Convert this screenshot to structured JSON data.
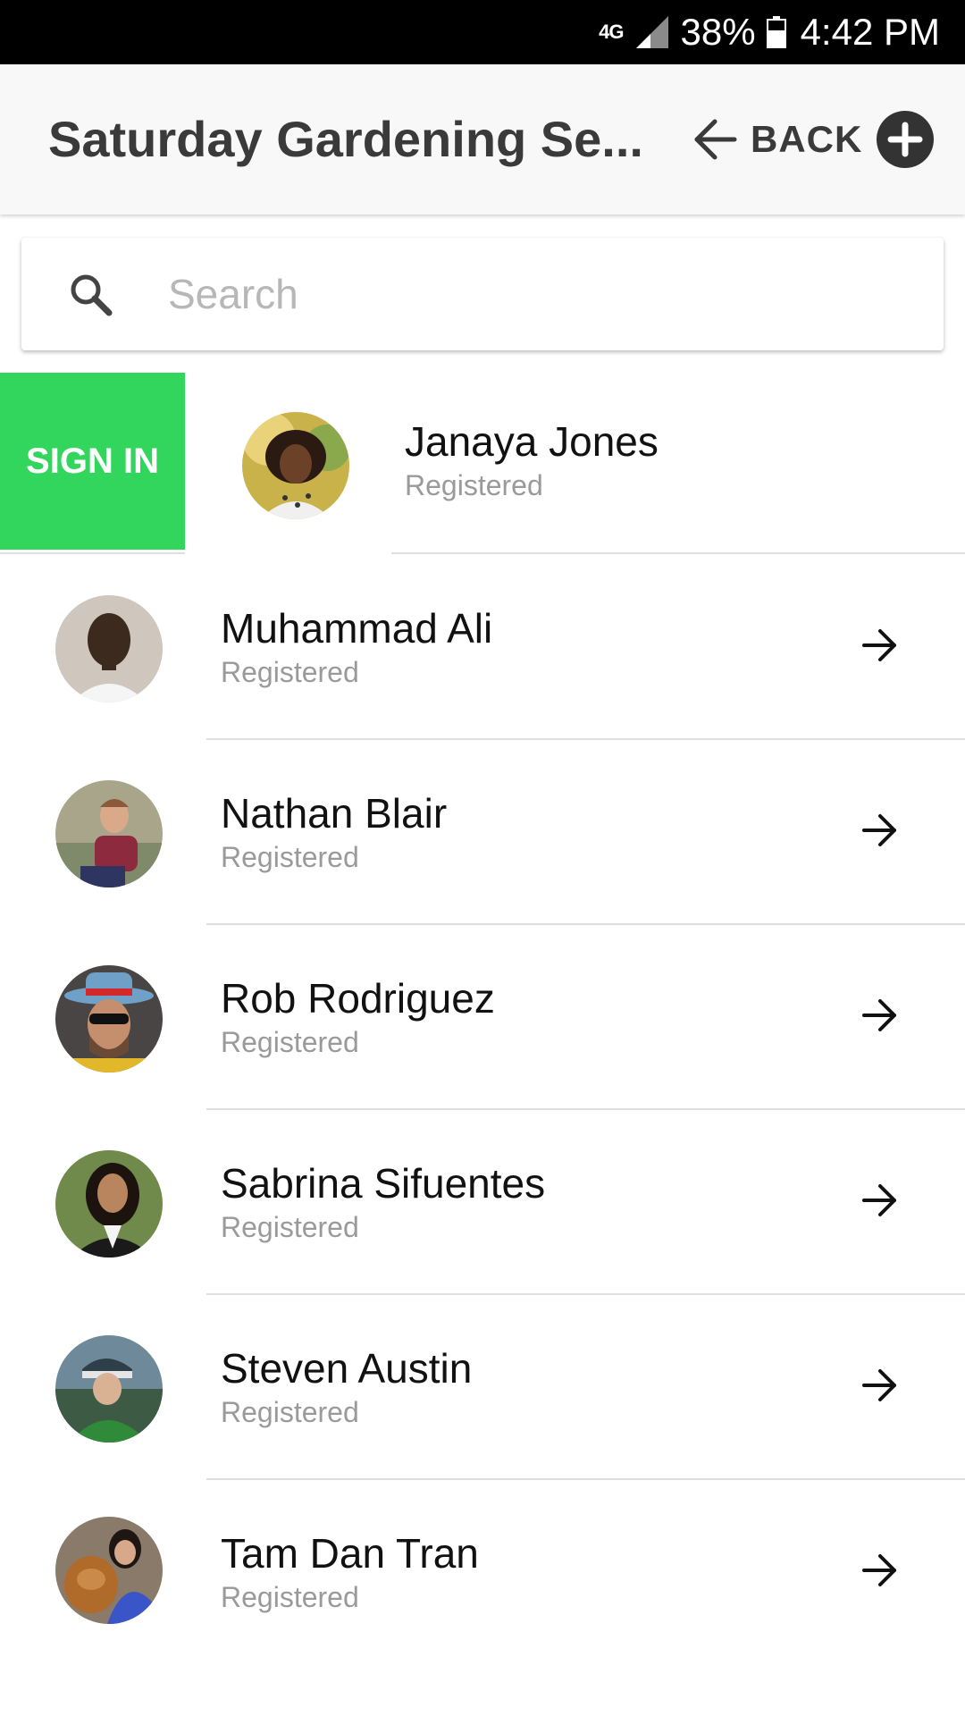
{
  "status_bar": {
    "network": "4G",
    "network_sub": "LTE",
    "battery": "38%",
    "time": "4:42 PM"
  },
  "app_bar": {
    "title": "Saturday Gardening Se...",
    "back_label": "BACK",
    "icons": {
      "back": "arrow-left-icon",
      "add": "plus-circle-icon"
    }
  },
  "search": {
    "placeholder": "Search",
    "value": "",
    "icon": "search-icon"
  },
  "swipe_action": {
    "label": "SIGN IN",
    "color": "#33d65c"
  },
  "attendees": [
    {
      "name": "Janaya Jones",
      "status": "Registered"
    },
    {
      "name": "Muhammad Ali",
      "status": "Registered"
    },
    {
      "name": "Nathan Blair",
      "status": "Registered"
    },
    {
      "name": "Rob Rodriguez",
      "status": "Registered"
    },
    {
      "name": "Sabrina Sifuentes",
      "status": "Registered"
    },
    {
      "name": "Steven Austin",
      "status": "Registered"
    },
    {
      "name": "Tam Dan Tran",
      "status": "Registered"
    }
  ],
  "row_icon": "arrow-right-icon"
}
